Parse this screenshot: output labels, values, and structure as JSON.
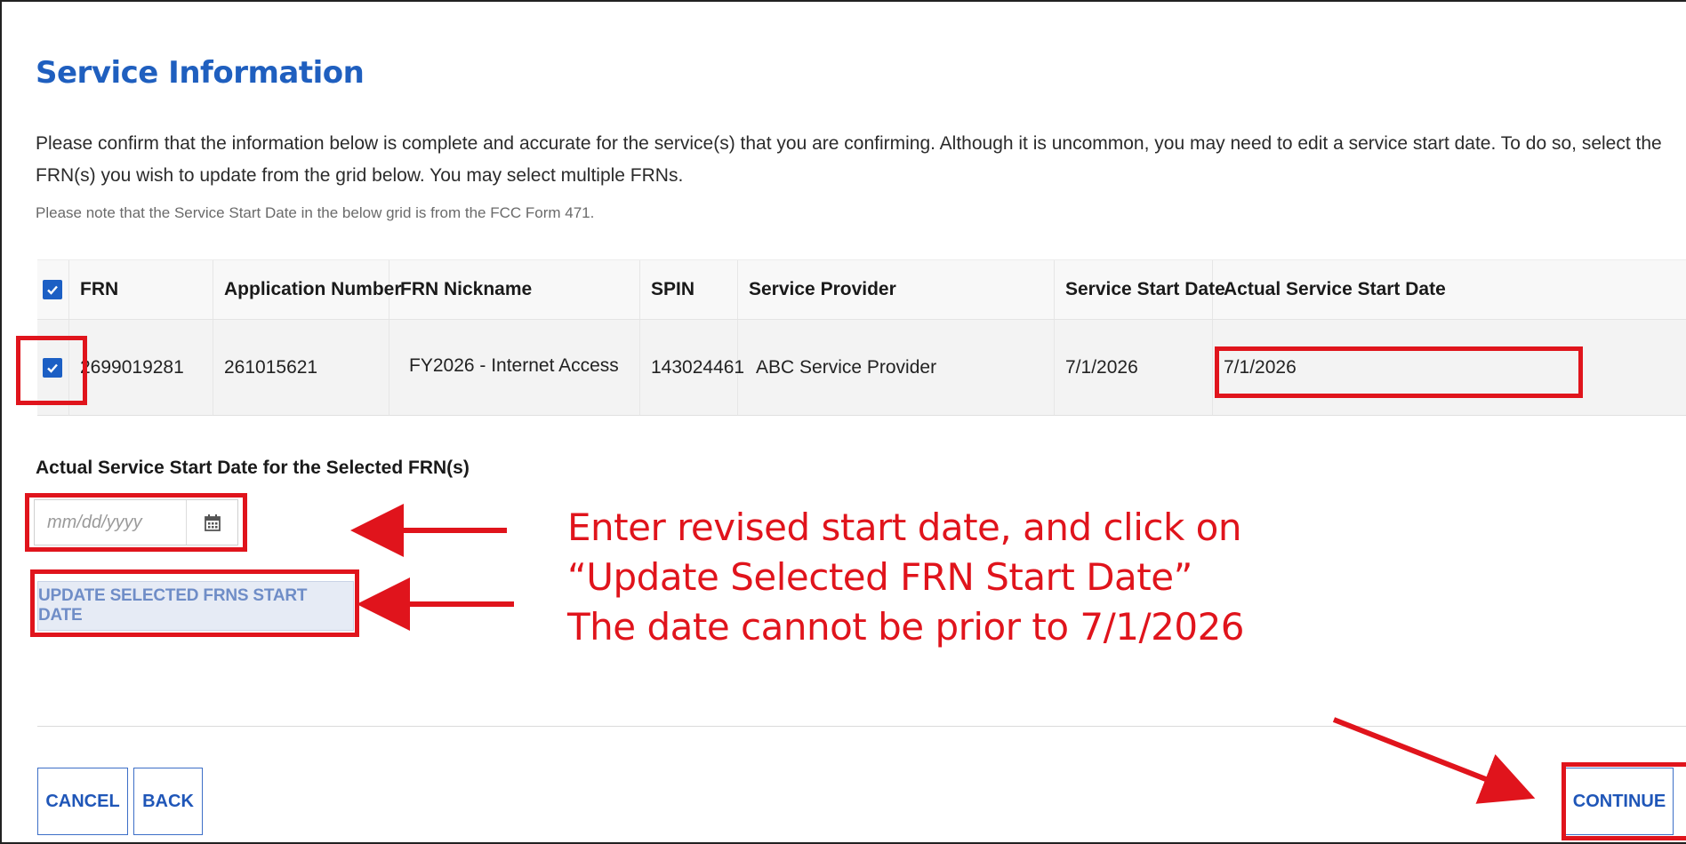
{
  "page": {
    "title": "Service Information",
    "intro": "Please confirm that the information below is complete and accurate for the service(s) that you are confirming. Although it is uncommon, you may need to edit a service start date. To do so, select the FRN(s) you wish to update from the grid below. You may select multiple FRNs.",
    "note": "Please note that the Service Start Date in the below grid is from the FCC Form 471."
  },
  "grid": {
    "headers": {
      "frn": "FRN",
      "app": "Application Number",
      "nick": "FRN Nickname",
      "spin": "SPIN",
      "provider": "Service Provider",
      "start": "Service Start Date",
      "actual": "Actual Service Start Date"
    },
    "rows": [
      {
        "frn": "2699019281",
        "app": "261015621",
        "nick": "FY2026 - Internet Access",
        "spin": "143024461",
        "provider": "ABC Service Provider",
        "start": "7/1/2026",
        "actual": "7/1/2026",
        "checked": true
      }
    ],
    "select_all_checked": true
  },
  "date_section": {
    "label": "Actual Service Start Date for the Selected FRN(s)",
    "placeholder": "mm/dd/yyyy",
    "update_button": "UPDATE SELECTED FRNS START DATE"
  },
  "footer": {
    "cancel": "CANCEL",
    "back": "BACK",
    "continue": "CONTINUE"
  },
  "annotation": {
    "line1": "Enter revised start date, and click on",
    "line2": "“Update Selected FRN Start Date”",
    "line3": "The date cannot be prior to 7/1/2026",
    "color": "#e0141c"
  },
  "colors": {
    "accent": "#1f5fbf",
    "checkbox": "#1c5fc4",
    "highlight": "#e0141c"
  },
  "icons": [
    "check-icon",
    "calendar-icon",
    "arrow-icon"
  ]
}
